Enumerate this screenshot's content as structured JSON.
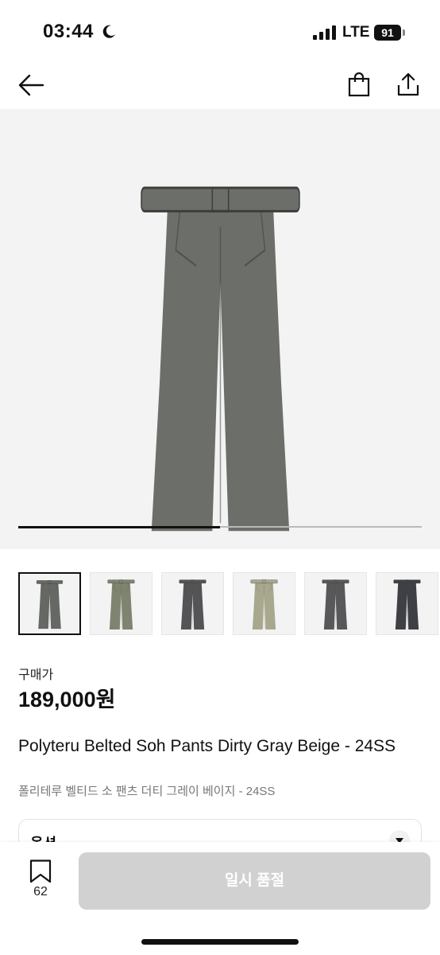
{
  "status_bar": {
    "time": "03:44",
    "moon_icon": "moon-icon",
    "signal_icon": "cellular-signal-icon",
    "network": "LTE",
    "battery": "91"
  },
  "nav": {
    "back_icon": "arrow-left-icon",
    "bag_icon": "shopping-bag-icon",
    "share_icon": "share-icon"
  },
  "gallery": {
    "progress": 0.5,
    "main_color": "#6c6e69",
    "thumbnails": [
      {
        "color": "#666863",
        "selected": true
      },
      {
        "color": "#7f8470",
        "selected": false
      },
      {
        "color": "#545456",
        "selected": false
      },
      {
        "color": "#a8a88f",
        "selected": false
      },
      {
        "color": "#58585b",
        "selected": false
      },
      {
        "color": "#3f4046",
        "selected": false
      }
    ]
  },
  "product": {
    "price_label": "구매가",
    "price": "189,000원",
    "title": "Polyteru Belted Soh Pants Dirty Gray Beige - 24SS",
    "subtitle": "폴리테루 벨티드 소 팬츠 더티 그레이 베이지 - 24SS"
  },
  "option": {
    "label": "옵션"
  },
  "bottom_bar": {
    "bookmark_icon": "bookmark-icon",
    "bookmark_count": "62",
    "buy_label": "일시 품절"
  }
}
